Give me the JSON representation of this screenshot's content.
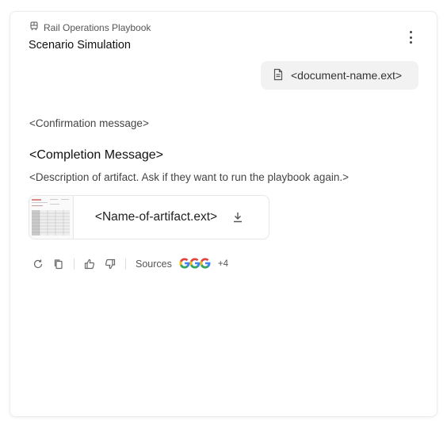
{
  "header": {
    "playbook_label": "Rail Operations Playbook",
    "title": "Scenario Simulation"
  },
  "attachment": {
    "name": "<document-name.ext>"
  },
  "messages": {
    "confirmation": "<Confirmation message>",
    "completion": "<Completion Message>",
    "description": "<Description of artifact. Ask if they want to run the playbook again.>"
  },
  "artifact": {
    "name": "<Name-of-artifact.ext>"
  },
  "actions": {
    "sources_label": "Sources",
    "sources_more": "+4"
  },
  "icons": {
    "playbook": "train-icon",
    "menu": "more-vertical-icon",
    "document": "document-icon",
    "download": "download-icon",
    "regenerate": "refresh-icon",
    "copy": "copy-icon",
    "like": "thumbs-up-icon",
    "dislike": "thumbs-down-icon",
    "source": "google-icon"
  },
  "colors": {
    "google_red": "#EA4335",
    "google_yellow": "#FBBC05",
    "google_green": "#34A853",
    "google_blue": "#4285F4"
  }
}
